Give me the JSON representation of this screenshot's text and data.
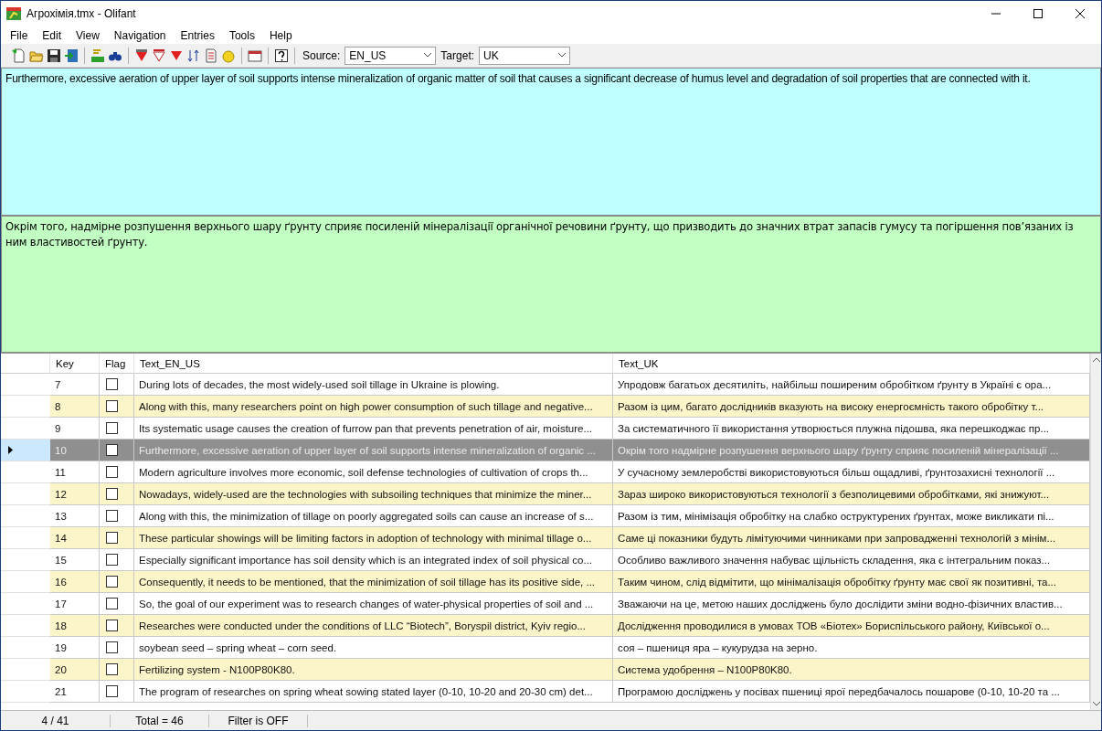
{
  "window": {
    "title": "Агрохімія.tmx - Olifant"
  },
  "menu": [
    "File",
    "Edit",
    "View",
    "Navigation",
    "Entries",
    "Tools",
    "Help"
  ],
  "toolbar": {
    "source_label": "Source:",
    "source_value": "EN_US",
    "target_label": "Target:",
    "target_value": "UK"
  },
  "source_text": "Furthermore, excessive aeration of upper layer of soil supports intense mineralization of organic matter of soil that causes a significant decrease of humus level and degradation of soil properties that are connected with it.",
  "target_text": "Окрім того, надмірне розпушення верхнього шару ґрунту сприяє посиленій мінералізації органічної речовини ґрунту, що призводить до значних втрат запасів гумусу та погіршення пов’язаних із ним властивостей ґрунту.",
  "table": {
    "columns": [
      "Key",
      "Flag",
      "Text_EN_US",
      "Text_UK"
    ],
    "rows": [
      {
        "key": "7",
        "flag": false,
        "selected": false,
        "en": "During lots of decades, the most widely-used soil tillage in Ukraine is plowing.",
        "uk": "Упродовж багатьох десятиліть, найбільш поширеним обробітком ґрунту в Україні є ора..."
      },
      {
        "key": "8",
        "flag": false,
        "selected": false,
        "en": "Along with this, many researchers point on high power consumption of such tillage and negative...",
        "uk": "Разом із цим, багато дослідників вказують на високу енергоємність такого обробітку т..."
      },
      {
        "key": "9",
        "flag": false,
        "selected": false,
        "en": "Its systematic usage causes the creation of furrow pan that prevents penetration of air, moisture...",
        "uk": "За систематичного її використання утворюється плужна підошва, яка перешкоджає пр..."
      },
      {
        "key": "10",
        "flag": false,
        "selected": true,
        "en": "Furthermore, excessive aeration of upper layer of soil supports intense mineralization of organic ...",
        "uk": "Окрім того надмірне розпушення верхнього шару ґрунту сприяє посиленій мінералізації ..."
      },
      {
        "key": "11",
        "flag": false,
        "selected": false,
        "en": "Modern agriculture involves more economic, soil defense technologies of cultivation of crops th...",
        "uk": "У сучасному землеробстві використовуються більш ощадливі, ґрунтозахисні технології ..."
      },
      {
        "key": "12",
        "flag": false,
        "selected": false,
        "en": "Nowadays, widely-used are the technologies with subsoiling techniques that minimize the miner...",
        "uk": "Зараз широко використовуються технології з безполицевими обробітками, які знижуют..."
      },
      {
        "key": "13",
        "flag": false,
        "selected": false,
        "en": "Along with this, the minimization of tillage on poorly aggregated soils can cause an increase of s...",
        "uk": "Разом із тим, мінімізація обробітку на слабко оструктурених ґрунтах, може викликати пі..."
      },
      {
        "key": "14",
        "flag": false,
        "selected": false,
        "en": "These particular showings will be limiting factors in adoption of technology with minimal tillage o...",
        "uk": "Саме ці показники будуть лімітуючими чинниками при запровадженні технологій з мінім..."
      },
      {
        "key": "15",
        "flag": false,
        "selected": false,
        "en": "Especially significant importance has soil density which is an integrated index of soil physical co...",
        "uk": "Особливо важливого значення набуває щільність складення, яка є інтегральним показ..."
      },
      {
        "key": "16",
        "flag": false,
        "selected": false,
        "en": "Consequently, it needs to be mentioned, that the minimization of soil tillage has its positive side, ...",
        "uk": "Таким чином, слід відмітити, що мінімалізація обробітку ґрунту має свої як позитивні, та..."
      },
      {
        "key": "17",
        "flag": false,
        "selected": false,
        "en": "So, the goal of our experiment was to research changes of water-physical properties of soil and ...",
        "uk": "Зважаючи на це, метою наших досліджень було дослідити зміни водно-фізичних властив..."
      },
      {
        "key": "18",
        "flag": false,
        "selected": false,
        "en": "Researches were conducted under the conditions of LLC “Biotech”, Boryspil district, Kyiv regio...",
        "uk": "Дослідження проводилися в умовах ТОВ «Біотех» Бориспільського району, Київської о..."
      },
      {
        "key": "19",
        "flag": false,
        "selected": false,
        "en": "soybean seed – spring wheat – corn seed.",
        "uk": " соя – пшениця яра – кукурудза на зерно."
      },
      {
        "key": "20",
        "flag": false,
        "selected": false,
        "en": "Fertilizing system - N100P80K80.",
        "uk": "Система удобрення – N100P80K80."
      },
      {
        "key": "21",
        "flag": false,
        "selected": false,
        "en": "The program of researches on spring wheat sowing stated layer (0-10, 10-20 and 20-30 cm) det...",
        "uk": "Програмою досліджень у посівах пшениці ярої передбачалось пошарове (0-10, 10-20 та ..."
      }
    ]
  },
  "status_bar": [
    "4 / 41",
    "Total = 46",
    "Filter is OFF"
  ]
}
